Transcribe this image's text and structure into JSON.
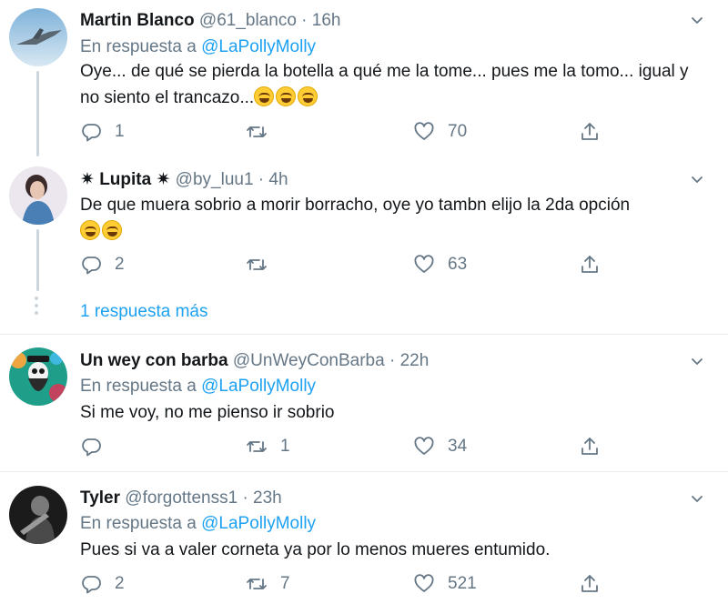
{
  "tweets": [
    {
      "name": "Martin Blanco",
      "handle": "@61_blanco",
      "time": "16h",
      "reply_label": "En respuesta a",
      "reply_to": "@LaPollyMolly",
      "text": "Oye... de qué se pierda la botella a qué me la tome... pues me la tomo... igual y no siento el trancazo...",
      "emoji": [
        "rolling-on-floor-laughing",
        "rolling-on-floor-laughing",
        "rolling-on-floor-laughing"
      ],
      "replies": "1",
      "retweets": "",
      "likes": "70"
    },
    {
      "name": "✷ Lupita ✷",
      "handle": "@by_luu1",
      "time": "4h",
      "text": "De que muera sobrio a morir borracho, oye yo tambn elijo la 2da opción",
      "emoji": [
        "tears-of-joy",
        "tears-of-joy"
      ],
      "replies": "2",
      "retweets": "",
      "likes": "63"
    },
    {
      "name": "Un wey con barba",
      "handle": "@UnWeyConBarba",
      "time": "22h",
      "reply_label": "En respuesta a",
      "reply_to": "@LaPollyMolly",
      "text": "Si me voy, no me pienso ir sobrio",
      "replies": "",
      "retweets": "1",
      "likes": "34"
    },
    {
      "name": "Tyler",
      "handle": "@forgottenss1",
      "time": "23h",
      "reply_label": "En respuesta a",
      "reply_to": "@LaPollyMolly",
      "text": "Pues si va a valer corneta ya por lo menos mueres entumido.",
      "replies": "2",
      "retweets": "7",
      "likes": "521"
    }
  ],
  "more_replies": "1 respuesta más",
  "separator": "·",
  "colors": {
    "link": "#1da1f2",
    "secondary": "#657786",
    "thread_line": "#ccd6dd",
    "divider": "#e6ecf0"
  },
  "icons": [
    "reply-icon",
    "retweet-icon",
    "like-icon",
    "share-icon",
    "chevron-down-icon"
  ]
}
